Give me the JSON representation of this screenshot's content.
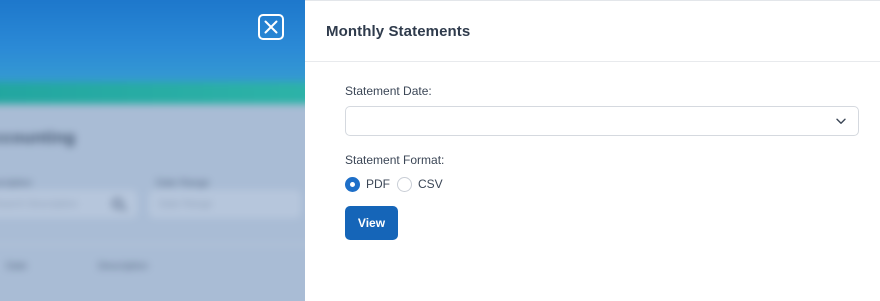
{
  "background": {
    "title": "Accounting",
    "description_label": "Description",
    "date_range_label": "Date Range",
    "description_placeholder": "Search Description",
    "date_range_placeholder": "Date Range",
    "column_date": "Date",
    "column_description": "Description"
  },
  "drawer": {
    "title": "Monthly Statements",
    "close_icon": "close-icon",
    "statement_date": {
      "label": "Statement Date:",
      "value": ""
    },
    "statement_format": {
      "label": "Statement Format:",
      "options": [
        {
          "label": "PDF",
          "checked": true
        },
        {
          "label": "CSV",
          "checked": false
        }
      ]
    },
    "view_button_label": "View"
  },
  "colors": {
    "primary": "#1565b8",
    "radio_checked": "#1e6fc8",
    "header_bar": "#1a73c9",
    "accent_stripe": "#22a6a0"
  }
}
